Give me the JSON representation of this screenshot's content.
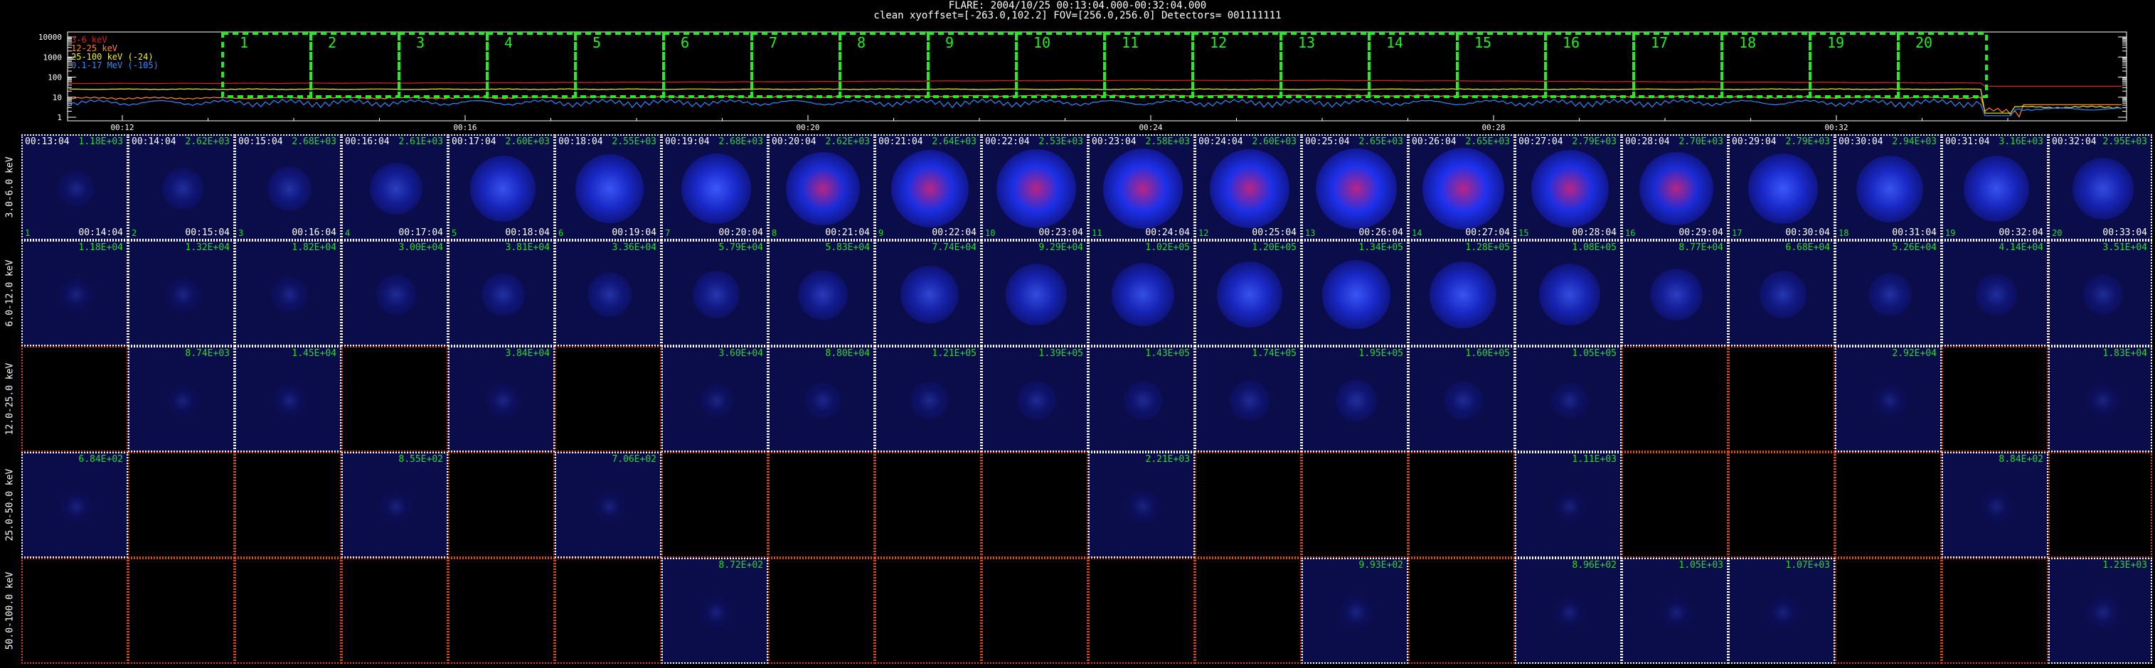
{
  "header": {
    "line1": "FLARE: 2004/10/25 00:13:04.000-00:32:04.000",
    "line2": "clean     xyoffset=[-263.0,102.2]     FOV=[256.0,256.0]     Detectors= 001111111"
  },
  "lightcurve": {
    "yticks": [
      "10000",
      "1000",
      "100",
      "10",
      "1"
    ],
    "xticks": [
      "00:12",
      "00:16",
      "00:20",
      "00:24",
      "00:28",
      "00:32"
    ],
    "legend": [
      {
        "label": "3-6 keV",
        "color": "#dd2222"
      },
      {
        "label": "12-25 keV",
        "color": "#ff8833"
      },
      {
        "label": "25-100 keV (-24)",
        "color": "#eeee22"
      },
      {
        "label": "0.1-17 MeV (-105)",
        "color": "#3388ff"
      }
    ],
    "intervals": [
      "1",
      "2",
      "3",
      "4",
      "5",
      "6",
      "7",
      "8",
      "9",
      "10",
      "11",
      "12",
      "13",
      "14",
      "15",
      "16",
      "17",
      "18",
      "19",
      "20"
    ]
  },
  "grid": {
    "start_times": [
      "00:13:04",
      "00:14:04",
      "00:15:04",
      "00:16:04",
      "00:17:04",
      "00:18:04",
      "00:19:04",
      "00:20:04",
      "00:21:04",
      "00:22:04",
      "00:23:04",
      "00:24:04",
      "00:25:04",
      "00:26:04",
      "00:27:04",
      "00:28:04",
      "00:29:04",
      "00:30:04",
      "00:31:04",
      "00:32:04"
    ],
    "end_times": [
      "00:14:04",
      "00:15:04",
      "00:16:04",
      "00:17:04",
      "00:18:04",
      "00:19:04",
      "00:20:04",
      "00:21:04",
      "00:22:04",
      "00:23:04",
      "00:24:04",
      "00:25:04",
      "00:26:04",
      "00:27:04",
      "00:28:04",
      "00:29:04",
      "00:30:04",
      "00:31:04",
      "00:32:04",
      "00:33:04"
    ],
    "rows": [
      {
        "label": "3.0-6.0 keV",
        "values": [
          "1.18E+03",
          "2.62E+03",
          "2.68E+03",
          "2.61E+03",
          "2.60E+03",
          "2.55E+03",
          "2.68E+03",
          "2.62E+03",
          "2.64E+03",
          "2.53E+03",
          "2.58E+03",
          "2.60E+03",
          "2.65E+03",
          "2.65E+03",
          "2.79E+03",
          "2.70E+03",
          "2.79E+03",
          "2.94E+03",
          "3.16E+03",
          "2.95E+03"
        ]
      },
      {
        "label": "6.0-12.0 keV",
        "values": [
          "1.18E+04",
          "1.32E+04",
          "1.82E+04",
          "3.00E+04",
          "3.81E+04",
          "3.36E+04",
          "5.79E+04",
          "5.83E+04",
          "7.74E+04",
          "9.29E+04",
          "1.02E+05",
          "1.20E+05",
          "1.34E+05",
          "1.28E+05",
          "1.08E+05",
          "8.77E+04",
          "6.68E+04",
          "5.26E+04",
          "4.14E+04",
          "3.51E+04"
        ]
      },
      {
        "label": "12.0-25.0 keV",
        "values": [
          "",
          "8.74E+03",
          "1.45E+04",
          "",
          "3.84E+04",
          "",
          "3.60E+04",
          "8.80E+04",
          "1.21E+05",
          "1.39E+05",
          "1.43E+05",
          "1.74E+05",
          "1.95E+05",
          "1.60E+05",
          "1.05E+05",
          "",
          "",
          "2.92E+04",
          "",
          "1.83E+04"
        ]
      },
      {
        "label": "25.0-50.0 keV",
        "values": [
          "6.84E+02",
          "",
          "",
          "8.55E+02",
          "",
          "7.06E+02",
          "",
          "",
          "",
          "",
          "2.21E+03",
          "",
          "",
          "",
          "1.11E+03",
          "",
          "",
          "",
          "8.84E+02",
          ""
        ]
      },
      {
        "label": "50.0-100.0 keV",
        "values": [
          "",
          "",
          "",
          "",
          "",
          "",
          "8.72E+02",
          "",
          "",
          "",
          "",
          "",
          "9.93E+02",
          "",
          "8.96E+02",
          "1.05E+03",
          "1.07E+03",
          "",
          "",
          "1.23E+03"
        ]
      }
    ],
    "intensity": [
      [
        0.15,
        0.25,
        0.3,
        0.45,
        0.7,
        0.75,
        0.78,
        0.85,
        0.92,
        0.95,
        0.97,
        0.95,
        0.98,
        1.0,
        0.92,
        0.85,
        0.78,
        0.72,
        0.7,
        0.62
      ],
      [
        0.1,
        0.12,
        0.15,
        0.22,
        0.28,
        0.3,
        0.35,
        0.4,
        0.55,
        0.62,
        0.65,
        0.7,
        0.75,
        0.72,
        0.62,
        0.45,
        0.35,
        0.28,
        0.25,
        0.22
      ],
      [
        0,
        0.08,
        0.1,
        0,
        0.12,
        0,
        0.12,
        0.15,
        0.18,
        0.2,
        0.2,
        0.22,
        0.25,
        0.2,
        0.15,
        0,
        0,
        0.1,
        0,
        0.1
      ],
      [
        0.08,
        0,
        0,
        0.08,
        0,
        0.08,
        0,
        0,
        0,
        0,
        0.1,
        0,
        0,
        0,
        0.08,
        0,
        0,
        0,
        0.08,
        0
      ],
      [
        0,
        0,
        0,
        0,
        0,
        0,
        0.08,
        0,
        0,
        0,
        0,
        0,
        0.1,
        0,
        0.08,
        0.08,
        0.08,
        0,
        0,
        0.1
      ]
    ]
  }
}
